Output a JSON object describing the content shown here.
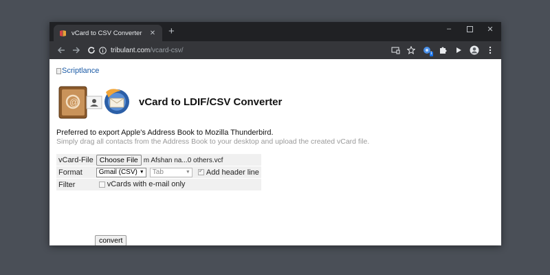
{
  "browser": {
    "tab": {
      "title": "vCard to CSV Converter"
    },
    "omnibox": {
      "domain": "tribulant.com",
      "path": "/vcard-csv/"
    },
    "extension_badge": "1",
    "colors": {
      "titlebar": "#202124",
      "toolbar": "#35363a",
      "accent": "#1a73e8"
    }
  },
  "page": {
    "broken_image_alt": "Scriptlance",
    "title": "vCard to LDIF/CSV Converter",
    "intro": "Preferred to export Apple's Address Book to Mozilla Thunderbird.",
    "intro_sub": "Simply drag all contacts from the Address Book to your desktop and upload the created vCard file.",
    "form": {
      "vcard_label": "vCard-File",
      "choose_file_label": "Choose File",
      "file_name": "m Afshan na...0 others.vcf",
      "format_label": "Format",
      "format_selected": "Gmail (CSV)",
      "delimiter_selected": "Tab",
      "header_line_label": "Add header line",
      "header_line_checked": true,
      "filter_label": "Filter",
      "email_only_label": "vCards with e-mail only",
      "email_only_checked": false,
      "convert_label": "convert"
    }
  }
}
